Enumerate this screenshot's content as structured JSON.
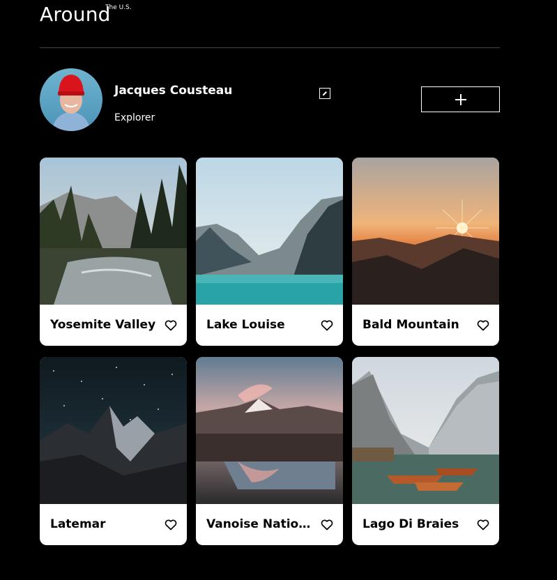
{
  "header": {
    "logo": "Around",
    "logo_sub": "The U.S."
  },
  "profile": {
    "name": "Jacques Cousteau",
    "about": "Explorer",
    "edit_icon": "pencil-icon",
    "add_icon": "plus-icon"
  },
  "cards": [
    {
      "title": "Yosemite Valley",
      "scene": "forest-river"
    },
    {
      "title": "Lake Louise",
      "scene": "mountain-lake"
    },
    {
      "title": "Bald Mountain",
      "scene": "sunset-hills"
    },
    {
      "title": "Latemar",
      "scene": "night-peaks"
    },
    {
      "title": "Vanoise National Park",
      "scene": "alpine-reflection"
    },
    {
      "title": "Lago Di Braies",
      "scene": "lake-boats"
    }
  ],
  "icons": {
    "like": "heart-icon"
  },
  "colors": {
    "background": "#000000",
    "card": "#ffffff",
    "text_dark": "#000000",
    "text_light": "#ffffff"
  }
}
